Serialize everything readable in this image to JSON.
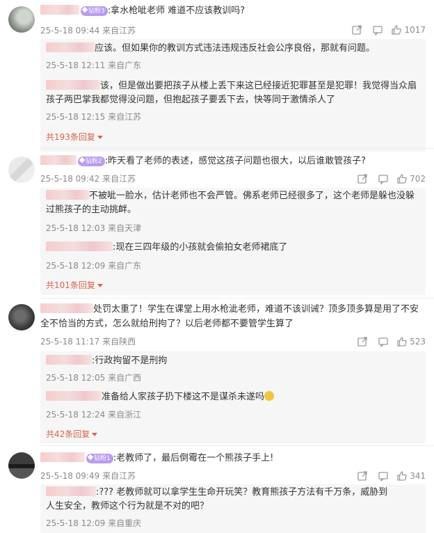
{
  "comments": [
    {
      "text": ":拿水枪呲老师   难道不应该教训吗?",
      "badge": "钻粉3",
      "time": "25-5-18 09:44",
      "location": "来自江苏",
      "likes": "1017",
      "replies": [
        {
          "text": "应该。但如果你的教训方式违法违规违反社会公序良俗，那就有问题。",
          "time": "25-5-18 12:11",
          "location": "来自广东"
        },
        {
          "lines": [
            "该，但是做出要把孩子从楼上丢下来这已经接近犯罪甚至是犯罪！我觉得当众扇",
            "孩子两巴掌我都觉得没问题，但抱起孩子要丢下去，快等同于激情杀人了"
          ],
          "time": "25-5-18 12:15",
          "location": "来自江苏"
        }
      ],
      "more": "共193条回复"
    },
    {
      "text": ":昨天看了老师的表述，感觉这孩子问题也很大，以后谁敢管孩子?",
      "badge": "钻粉2",
      "time": "25-5-18 09:42",
      "location": "来自江苏",
      "likes": "702",
      "replies": [
        {
          "lines": [
            "不被呲一脸水，估计老师也不会严管。佛系老师已经很多了，这个老师是躲也没躲",
            "过熊孩子的主动挑衅。"
          ],
          "time": "25-5-18 12:03",
          "location": "来自天津"
        },
        {
          "text": ":现在三四年级的小孩就会偷拍女老师裙底了",
          "time": "25-5-18 12:09",
          "location": "来自广东"
        }
      ],
      "more": "共101条回复"
    },
    {
      "lines": [
        "处罚太重了！学生在课堂上用水枪泚老师，难道不该训诫？顶多顶多算是用了不安",
        "全不恰当的方式，怎么就给刑拘了？以后老师都不要管学生算了"
      ],
      "time": "25-5-18 11:17",
      "location": "来自陕西",
      "likes": "523",
      "replies": [
        {
          "text": ":行政拘留不是刑拘",
          "time": "25-5-18 12:05",
          "location": "来自广西"
        },
        {
          "text": "准备给人家孩子扔下楼这不是谋杀未遂吗",
          "time": "25-5-18 12:24",
          "location": "来自浙江"
        }
      ],
      "more": "共42条回复"
    },
    {
      "text": ":老教师了，最后倒霉在一个熊孩子手上!",
      "badge": "钻粉1",
      "time": "25-5-18 09:49",
      "location": "来自江苏",
      "likes": "341",
      "replies": [
        {
          "lines": [
            ":???  老教师就可以拿学生生命开玩笑？教育熊孩子方法有千万条，威胁到",
            "人生安全，教师这个行为就是不对的吧？"
          ],
          "time": "25-5-18 12:09",
          "location": "来自重庆"
        }
      ]
    }
  ],
  "icons": {
    "share": "share-icon",
    "comment": "comment-icon",
    "like": "like-icon"
  },
  "colors": {
    "accent": "#d6644a",
    "badge": "#b89cf0",
    "reply_bg": "#f6f6f6"
  }
}
